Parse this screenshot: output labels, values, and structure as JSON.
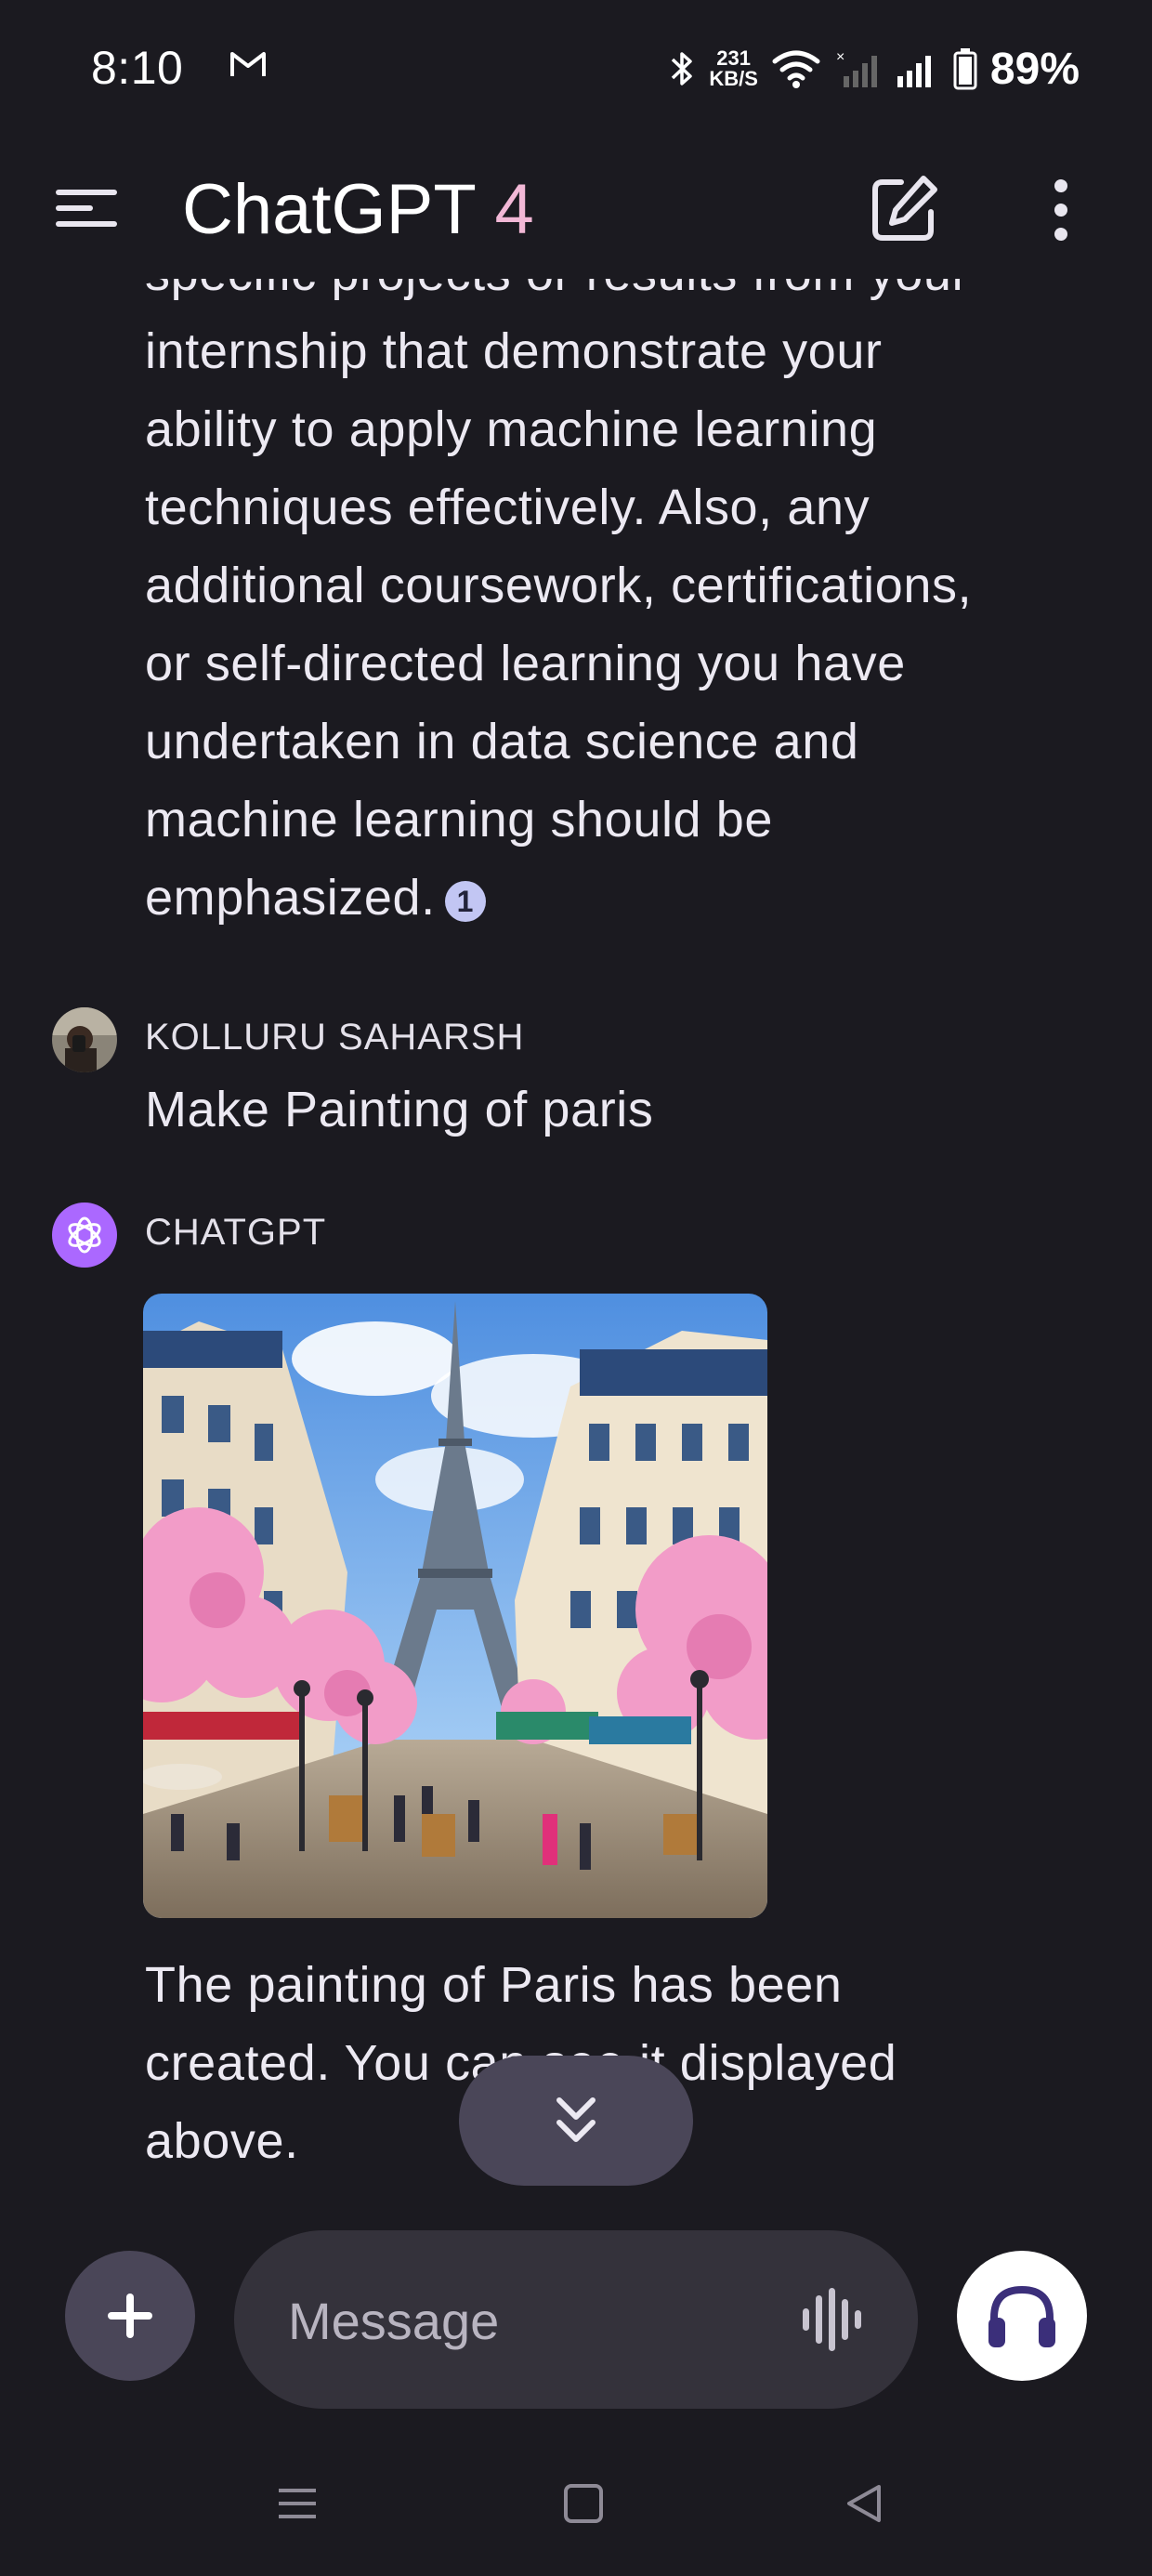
{
  "status_bar": {
    "time": "8:10",
    "net_speed_value": "231",
    "net_speed_unit": "KB/S",
    "battery": "89%",
    "icons": [
      "gmail-icon",
      "bluetooth-icon",
      "wifi-icon",
      "signal-off-icon",
      "signal-icon",
      "battery-icon"
    ]
  },
  "app_bar": {
    "title": "ChatGPT",
    "version": "4"
  },
  "messages": {
    "assistant_prev": {
      "partial_top": "specific projects or results from your",
      "lines": [
        "internship that demonstrate your",
        "ability to apply machine learning",
        "techniques effectively. Also, any",
        "additional coursework, certifications,",
        "or self-directed learning you have",
        "undertaken in data science and",
        "machine learning should be"
      ],
      "last_line": "emphasized.",
      "citation": "1"
    },
    "user": {
      "sender": "KOLLURU SAHARSH",
      "text": "Make Painting of paris"
    },
    "assistant": {
      "sender": "CHATGPT",
      "lines": [
        "The painting of Paris has been",
        "created. You can see it displayed",
        "above."
      ]
    }
  },
  "composer": {
    "placeholder": "Message"
  },
  "colors": {
    "background": "#1b1a20",
    "accent_avatar": "#ab68ff",
    "title_version": "#f2b8d6",
    "citation_badge": "#c2c6f3",
    "button_bg": "#4a4658",
    "input_bg": "#34323b"
  }
}
